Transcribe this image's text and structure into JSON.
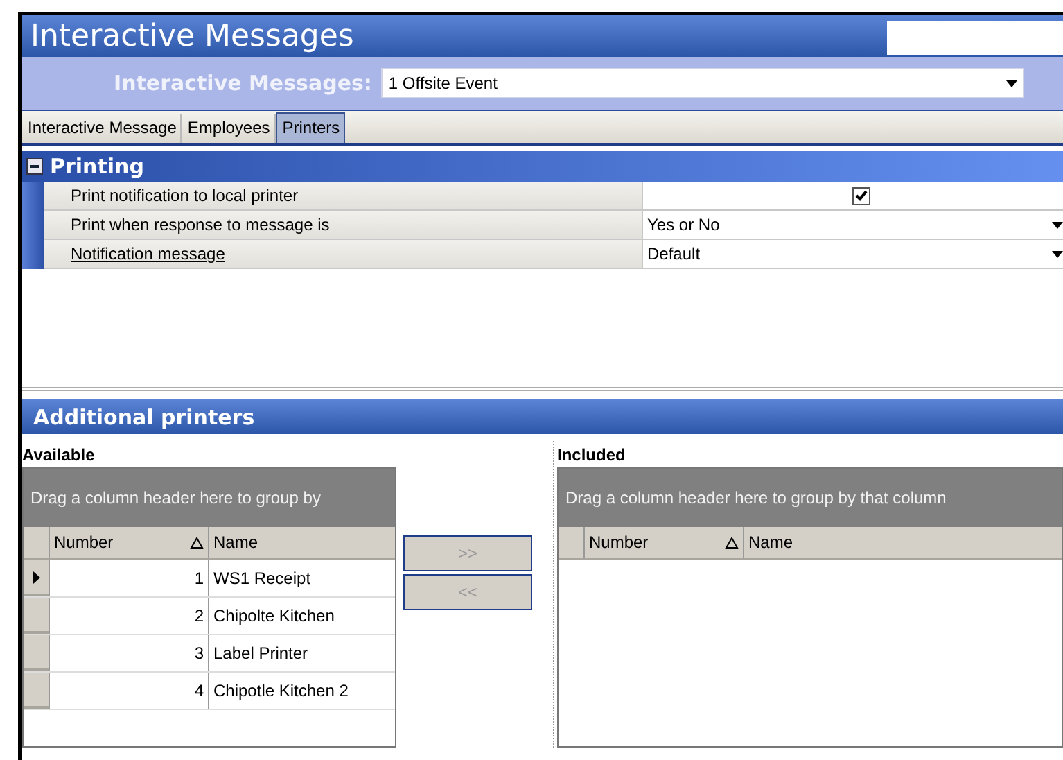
{
  "window": {
    "title": "Interactive Messages"
  },
  "selector": {
    "label": "Interactive Messages:",
    "value": "1 Offsite Event"
  },
  "tabs": [
    {
      "label": "Interactive Message",
      "selected": false
    },
    {
      "label": "Employees",
      "selected": false
    },
    {
      "label": "Printers",
      "selected": true
    }
  ],
  "printing": {
    "title": "Printing",
    "expanded": true,
    "rows": [
      {
        "kind": "checkbox",
        "label": "Print notification to local printer",
        "underlined": false,
        "checked": true
      },
      {
        "kind": "dropdown",
        "label": "Print when response to message is",
        "underlined": false,
        "value": "Yes or No"
      },
      {
        "kind": "dropdown",
        "label": "Notification message",
        "underlined": true,
        "value": "Default"
      }
    ]
  },
  "additional_printers": {
    "title": "Additional printers",
    "available": {
      "label": "Available",
      "group_hint": "Drag a column header here to group by",
      "columns": [
        "Number",
        "Name"
      ],
      "rows": [
        {
          "number": "1",
          "name": "WS1 Receipt",
          "current": true
        },
        {
          "number": "2",
          "name": "Chipolte Kitchen",
          "current": false
        },
        {
          "number": "3",
          "name": "Label Printer",
          "current": false
        },
        {
          "number": "4",
          "name": "Chipotle Kitchen 2",
          "current": false
        }
      ]
    },
    "buttons": [
      {
        "label": ">>",
        "disabled": true
      },
      {
        "label": "<<",
        "disabled": true
      }
    ],
    "included": {
      "label": "Included",
      "group_hint": "Drag a column header here to group by that column",
      "columns": [
        "Number",
        "Name"
      ]
    }
  }
}
